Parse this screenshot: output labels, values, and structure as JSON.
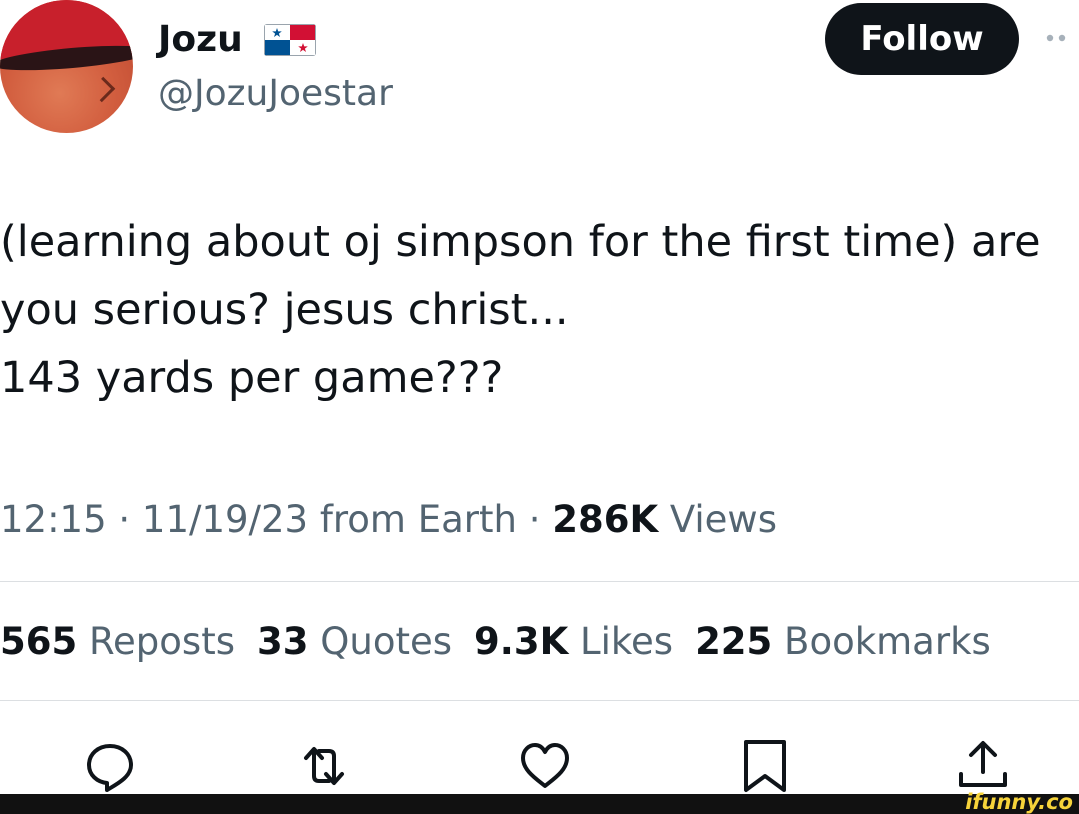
{
  "author": {
    "name": "Jozu",
    "handle": "@JozuJoestar",
    "flag_icon": "panama-flag-icon"
  },
  "header": {
    "follow_label": "Follow",
    "more_icon": "more-options-icon"
  },
  "tweet": {
    "lines": [
      "(learning about oj simpson for the first time) are",
      "you serious? jesus christ...",
      "143 yards per game???"
    ]
  },
  "meta": {
    "time_date": "12:15 · 11/19/23 from Earth · ",
    "views_count": "286K",
    "views_label": " Views"
  },
  "stats": [
    {
      "count": "565",
      "label": " Reposts"
    },
    {
      "count": "33",
      "label": " Quotes"
    },
    {
      "count": "9.3K",
      "label": " Likes"
    },
    {
      "count": "225",
      "label": " Bookmarks"
    }
  ],
  "actions": [
    "reply-icon",
    "repost-icon",
    "like-icon",
    "bookmark-icon",
    "share-icon"
  ],
  "watermark": "ifunny.co",
  "colors": {
    "text": "#0f1419",
    "secondary": "#536471",
    "button_bg": "#0f1419",
    "watermark": "#f6d33a"
  }
}
